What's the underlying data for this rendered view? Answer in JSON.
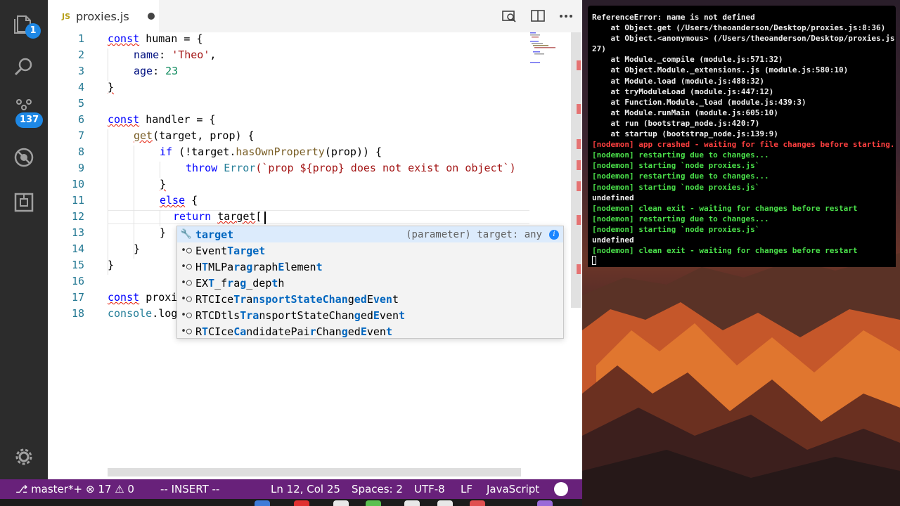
{
  "editor": {
    "tab": {
      "lang": "JS",
      "filename": "proxies.js"
    },
    "activity_badges": {
      "explorer": "1",
      "scm": "137"
    },
    "line_numbers": [
      "1",
      "2",
      "3",
      "4",
      "5",
      "6",
      "7",
      "8",
      "9",
      "10",
      "11",
      "12",
      "13",
      "14",
      "15",
      "16",
      "17",
      "18"
    ],
    "code": {
      "l1_kw": "const",
      "l1_name": "human",
      "l1_rest": " = {",
      "l2_key": "name",
      "l2_sep": ": ",
      "l2_val": "'Theo'",
      "l2_end": ",",
      "l3_key": "age",
      "l3_sep": ": ",
      "l3_val": "23",
      "l4": "}",
      "l6_kw": "const",
      "l6_name": "handler",
      "l6_rest": " = {",
      "l7_fn": "get",
      "l7_rest": "(target, prop) {",
      "l8_kw": "if",
      "l8_a": " (!target.",
      "l8_fn": "hasOwnProperty",
      "l8_b": "(prop)) {",
      "l9_kw": "throw",
      "l9_cls": "Error",
      "l9_str": "(`prop ${prop} does not exist on object`)",
      "l10": "}",
      "l11_kw": "else",
      "l11_rest": " {",
      "l12_kw": "return",
      "l12_name": "target",
      "l12_rest": "[",
      "l13": "}",
      "l14": "}",
      "l15": "}",
      "l17_kw": "const",
      "l17_name": "proxi",
      "l18_name": "console",
      "l18_rest": ".log"
    }
  },
  "suggest": {
    "selected": {
      "label": "target",
      "detail": "(parameter) target: any",
      "info_icon": "i"
    },
    "items": [
      {
        "icon": "wrench-icon",
        "glyph": "⚒",
        "parts": [
          "target"
        ]
      },
      {
        "icon": "method-icon",
        "glyph": "•○",
        "parts": [
          "Event",
          "Target"
        ]
      },
      {
        "icon": "method-icon",
        "glyph": "•○",
        "parts": [
          "H",
          "T",
          "MLPa",
          "r",
          "a",
          "g",
          "raph",
          "E",
          "lemen",
          "t"
        ]
      },
      {
        "icon": "method-icon",
        "glyph": "•○",
        "parts": [
          "EX",
          "T",
          "_f",
          "r",
          "a",
          "g",
          "_dep",
          "t",
          "h"
        ]
      },
      {
        "icon": "method-icon",
        "glyph": "•○",
        "parts": [
          "RTCIce",
          "Tr",
          "a",
          "nsportStateChan",
          "g",
          "ed",
          "E",
          "ven",
          "t"
        ]
      },
      {
        "icon": "method-icon",
        "glyph": "•○",
        "parts": [
          "RTCDtls",
          "Tra",
          "nsportStateChan",
          "g",
          "ed",
          "E",
          "ven",
          "t"
        ]
      },
      {
        "icon": "method-icon",
        "glyph": "•○",
        "parts": [
          "R",
          "T",
          "CIce",
          "Ca",
          "ndidatePai",
          "r",
          "Chan",
          "g",
          "ed",
          "E",
          "ven",
          "t"
        ]
      }
    ],
    "items_text": [
      "target",
      "EventTarget",
      "HTMLParagraphElement",
      "EXT_frag_depth",
      "RTCIceTransportStateChangedEvent",
      "RTCDtlsTransportStateChangedEvent",
      "RTCIceCandidatePairChangedEvent"
    ]
  },
  "status_bar": {
    "branch": "master*+",
    "errors": "17",
    "warnings": "0",
    "mode": "-- INSERT --",
    "position": "Ln 12, Col 25",
    "spaces": "Spaces: 2",
    "encoding": "UTF-8",
    "eol": "LF",
    "language": "JavaScript"
  },
  "terminal": {
    "lines": [
      {
        "color": "white",
        "text": "ReferenceError: name is not defined"
      },
      {
        "color": "white",
        "text": "    at Object.get (/Users/theoanderson/Desktop/proxies.js:8:36)"
      },
      {
        "color": "white",
        "text": "    at Object.<anonymous> (/Users/theoanderson/Desktop/proxies.js:15:"
      },
      {
        "color": "white",
        "text": "27)"
      },
      {
        "color": "white",
        "text": "    at Module._compile (module.js:571:32)"
      },
      {
        "color": "white",
        "text": "    at Object.Module._extensions..js (module.js:580:10)"
      },
      {
        "color": "white",
        "text": "    at Module.load (module.js:488:32)"
      },
      {
        "color": "white",
        "text": "    at tryModuleLoad (module.js:447:12)"
      },
      {
        "color": "white",
        "text": "    at Function.Module._load (module.js:439:3)"
      },
      {
        "color": "white",
        "text": "    at Module.runMain (module.js:605:10)"
      },
      {
        "color": "white",
        "text": "    at run (bootstrap_node.js:420:7)"
      },
      {
        "color": "white",
        "text": "    at startup (bootstrap_node.js:139:9)"
      },
      {
        "color": "red",
        "text": "[nodemon] app crashed - waiting for file changes before starting..."
      },
      {
        "color": "green",
        "text": "[nodemon] restarting due to changes..."
      },
      {
        "color": "green",
        "text": "[nodemon] starting `node proxies.js`"
      },
      {
        "color": "green",
        "text": "[nodemon] restarting due to changes..."
      },
      {
        "color": "green",
        "text": "[nodemon] starting `node proxies.js`"
      },
      {
        "color": "white",
        "text": "undefined"
      },
      {
        "color": "green",
        "text": "[nodemon] clean exit - waiting for changes before restart"
      },
      {
        "color": "green",
        "text": "[nodemon] restarting due to changes..."
      },
      {
        "color": "green",
        "text": "[nodemon] starting `node proxies.js`"
      },
      {
        "color": "white",
        "text": "undefined"
      },
      {
        "color": "green",
        "text": "[nodemon] clean exit - waiting for changes before restart"
      }
    ]
  },
  "colors": {
    "status_bar": "#68217a",
    "terminal_bg": "#000000",
    "keyword": "#0000ff",
    "string": "#a31515",
    "number": "#09885a",
    "error_squiggle": "#e51400",
    "suggest_highlight": "#0066bf"
  }
}
